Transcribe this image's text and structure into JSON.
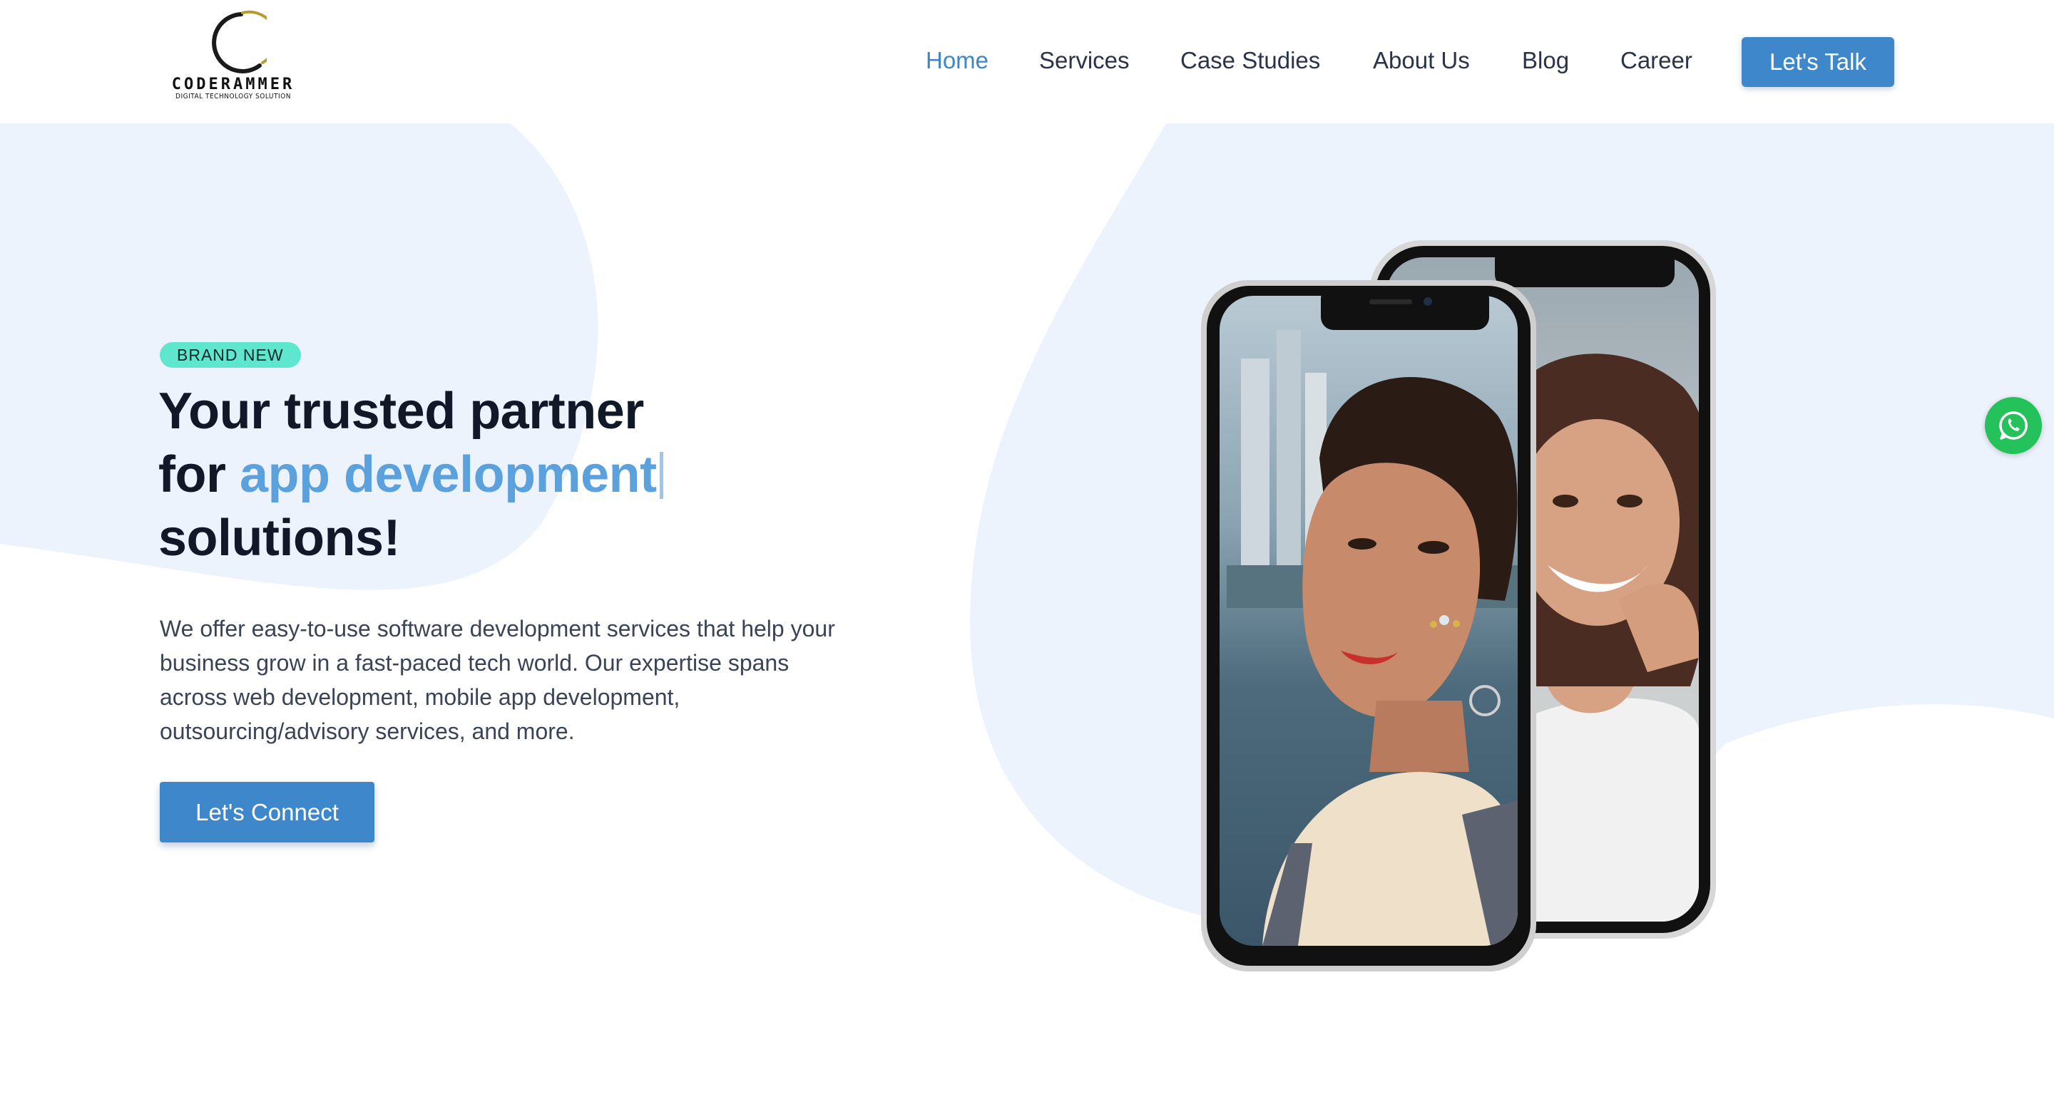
{
  "brand": {
    "name": "CODERAMMER",
    "tagline": "DIGITAL TECHNOLOGY SOLUTION",
    "logo_colors": {
      "crescent": "#1a1a1a",
      "swoosh": "#b89a2e"
    }
  },
  "nav": {
    "items": [
      {
        "label": "Home",
        "active": true
      },
      {
        "label": "Services",
        "active": false
      },
      {
        "label": "Case Studies",
        "active": false
      },
      {
        "label": "About Us",
        "active": false
      },
      {
        "label": "Blog",
        "active": false
      },
      {
        "label": "Career",
        "active": false
      }
    ],
    "cta_label": "Let's Talk"
  },
  "hero": {
    "badge": "BRAND NEW",
    "headline_line1": "Your trusted partner",
    "headline_line2_prefix": "for ",
    "headline_accent": "app development",
    "headline_line3": "solutions!",
    "description": "We offer easy-to-use software development services that help your business grow in a fast-paced tech world. Our expertise spans across web development, mobile app development, outsourcing/advisory services, and more.",
    "cta_label": "Let's Connect"
  },
  "floating": {
    "whatsapp_icon": "whatsapp-icon"
  },
  "colors": {
    "accent": "#3f87cb",
    "accent_light": "#5aa1dd",
    "badge": "#5ee6cf",
    "blob": "#edf3fd",
    "whatsapp": "#25c25b",
    "heading": "#111827"
  }
}
